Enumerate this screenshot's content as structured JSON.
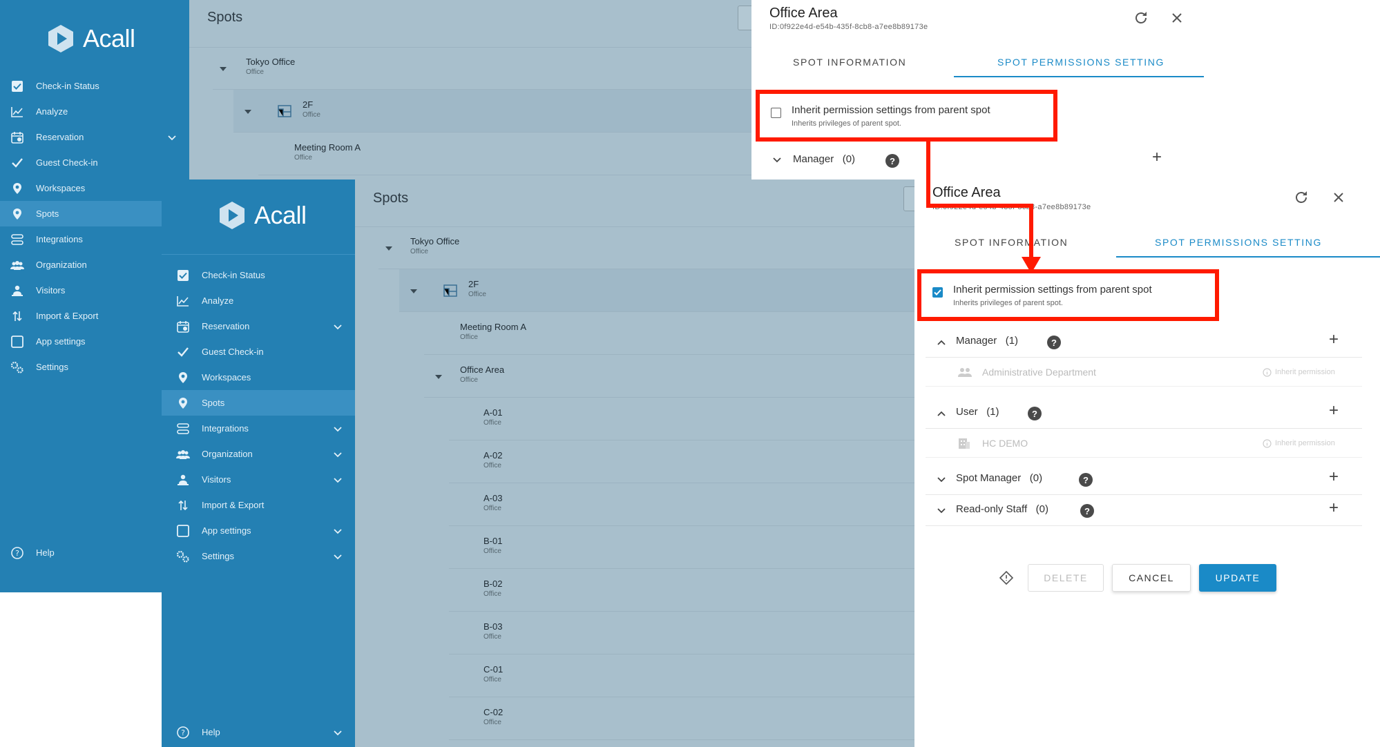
{
  "app": {
    "brand": "Acall"
  },
  "sidebar": {
    "items": [
      {
        "label": "Check-in Status",
        "icon": "check-square-icon"
      },
      {
        "label": "Analyze",
        "icon": "chart-line-icon"
      },
      {
        "label": "Reservation",
        "icon": "calendar-icon",
        "expandable": true
      },
      {
        "label": "Guest Check-in",
        "icon": "check-icon"
      },
      {
        "label": "Workspaces",
        "icon": "location-pin-icon"
      },
      {
        "label": "Spots",
        "icon": "spot-pin-icon",
        "active": true
      },
      {
        "label": "Integrations",
        "icon": "integrations-icon",
        "expandable": true
      },
      {
        "label": "Organization",
        "icon": "people-icon",
        "expandable": true
      },
      {
        "label": "Visitors",
        "icon": "visitor-icon",
        "expandable": true
      },
      {
        "label": "Import & Export",
        "icon": "import-export-icon"
      },
      {
        "label": "App settings",
        "icon": "tablet-icon",
        "expandable": true
      },
      {
        "label": "Settings",
        "icon": "gears-icon",
        "expandable": true
      }
    ],
    "help": "Help"
  },
  "spots_page": {
    "title": "Spots",
    "tree": [
      {
        "name": "Tokyo Office",
        "type": "Office"
      },
      {
        "name": "2F",
        "type": "Office"
      },
      {
        "name": "Meeting Room A",
        "type": "Office"
      },
      {
        "name": "Office Area",
        "type": "Office"
      },
      {
        "name": "A-01",
        "type": "Office"
      },
      {
        "name": "A-02",
        "type": "Office"
      },
      {
        "name": "A-03",
        "type": "Office"
      },
      {
        "name": "B-01",
        "type": "Office"
      },
      {
        "name": "B-02",
        "type": "Office"
      },
      {
        "name": "B-03",
        "type": "Office"
      },
      {
        "name": "C-01",
        "type": "Office"
      },
      {
        "name": "C-02",
        "type": "Office"
      }
    ]
  },
  "panel": {
    "title": "Office Area",
    "id": "ID:0f922e4d-e54b-435f-8cb8-a7ee8b89173e",
    "tabs": [
      "SPOT INFORMATION",
      "SPOT PERMISSIONS SETTING"
    ],
    "inherit_label": "Inherit permission settings from parent spot",
    "inherit_sub": "Inherits privileges of parent spot.",
    "sections_before": [
      {
        "label": "Manager",
        "count": "(0)"
      }
    ],
    "sections_after": [
      {
        "label": "Manager",
        "count": "(1)",
        "entry": "Administrative Department"
      },
      {
        "label": "User",
        "count": "(1)",
        "entry": "HC DEMO"
      },
      {
        "label": "Spot Manager",
        "count": "(0)"
      },
      {
        "label": "Read-only Staff",
        "count": "(0)"
      }
    ],
    "inherit_tag": "Inherit permission",
    "buttons": {
      "delete": "DELETE",
      "cancel": "CANCEL",
      "update": "UPDATE"
    }
  },
  "colors": {
    "sidebar": "#2480b3",
    "accent": "#1a8ac7",
    "highlight": "#ff1a00"
  }
}
